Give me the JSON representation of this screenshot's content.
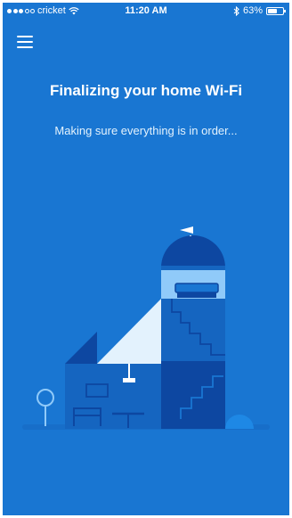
{
  "status_bar": {
    "carrier": "cricket",
    "time": "11:20 AM",
    "battery": "63%",
    "battery_level": 0.63,
    "signal_bars_filled": 3,
    "signal_bars_total": 5
  },
  "header": {
    "menu_icon": "hamburger-menu-icon"
  },
  "main": {
    "title": "Finalizing your home Wi-Fi",
    "subtitle": "Making sure everything is in order..."
  },
  "colors": {
    "background": "#1976d2",
    "dark_blue": "#1565c0",
    "navy": "#0d47a1",
    "light_blue": "#90caf9",
    "accent_blue": "#1e88e5"
  }
}
